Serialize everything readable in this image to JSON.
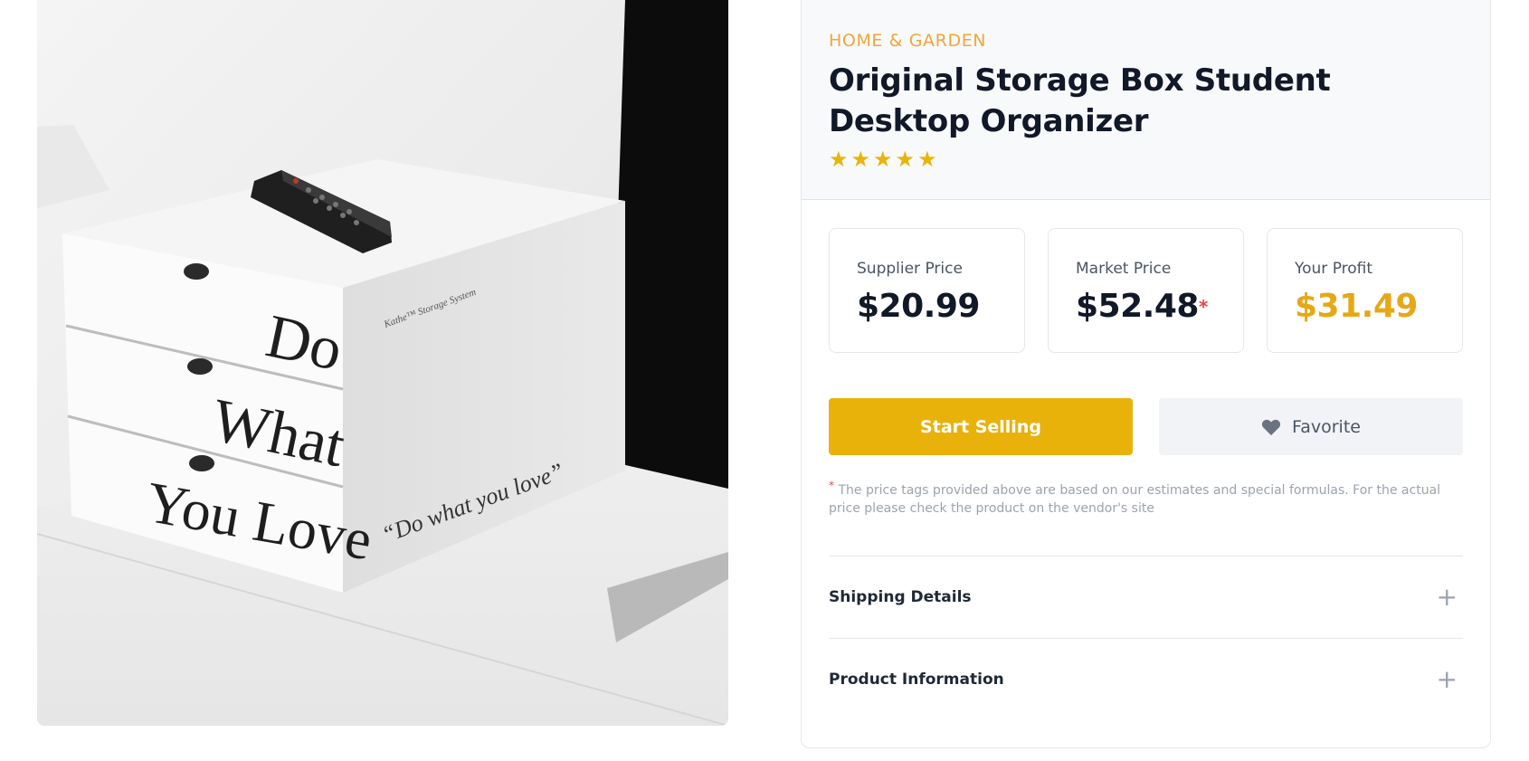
{
  "product": {
    "category": "HOME & GARDEN",
    "title": "Original Storage Box Student Desktop Organizer",
    "rating": 5,
    "image_alt": "Do What You Love storage box",
    "box_lettering": [
      "Do",
      "What",
      "You Love"
    ],
    "box_side_text": "“Do what you love”",
    "box_brand_text": "Kathe™ Storage System"
  },
  "prices": [
    {
      "label": "Supplier Price",
      "value": "$20.99",
      "highlight": false,
      "asterisk": false
    },
    {
      "label": "Market Price",
      "value": "$52.48",
      "highlight": false,
      "asterisk": true
    },
    {
      "label": "Your Profit",
      "value": "$31.49",
      "highlight": true,
      "asterisk": false
    }
  ],
  "asterisk_symbol": "*",
  "actions": {
    "start_selling": "Start Selling",
    "favorite": "Favorite"
  },
  "note": "The price tags provided above are based on our estimates and special formulas. For the actual price please check the product on the vendor's site",
  "accordion": [
    {
      "label": "Shipping Details",
      "icon": "plus-icon"
    },
    {
      "label": "Product Information",
      "icon": "plus-icon"
    }
  ],
  "colors": {
    "accent": "#e8b20b",
    "category": "#f1a63a",
    "profit": "#e6a817",
    "asterisk": "#ef4444",
    "star": "#eab308"
  }
}
